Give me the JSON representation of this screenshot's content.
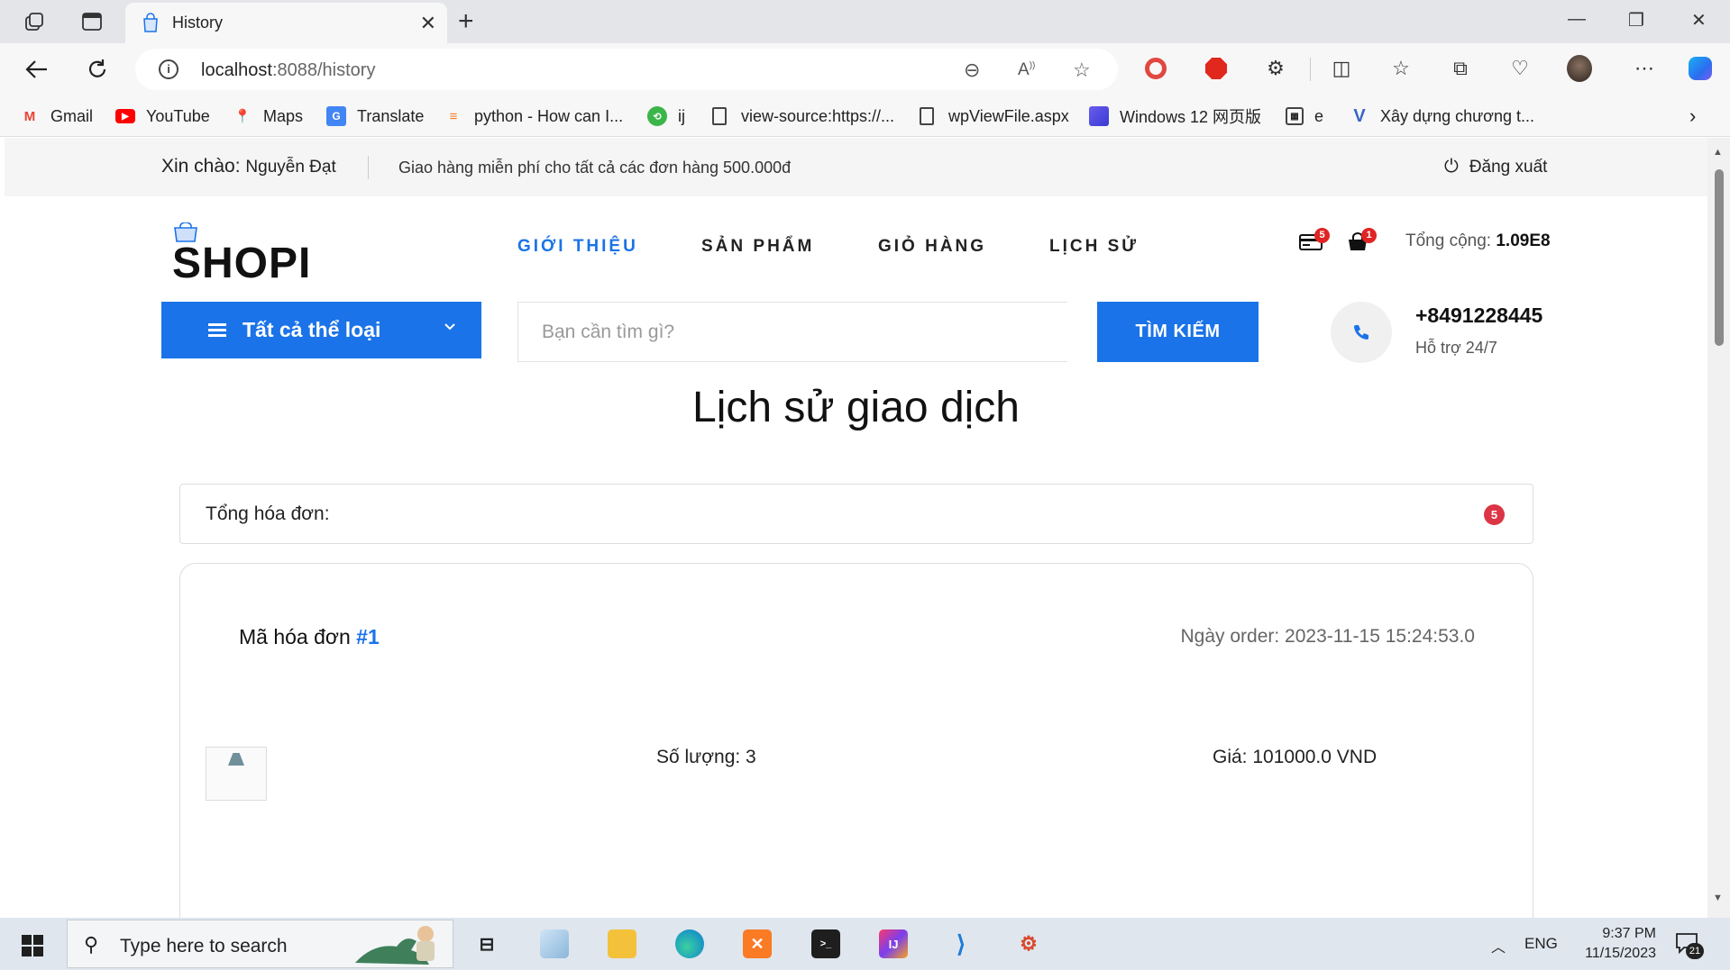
{
  "browser": {
    "tab_title": "History",
    "url_host": "localhost",
    "url_rest": ":8088/history",
    "bookmarks": [
      {
        "label": "Gmail",
        "icon": "gmail-icon"
      },
      {
        "label": "YouTube",
        "icon": "youtube-icon"
      },
      {
        "label": "Maps",
        "icon": "maps-icon"
      },
      {
        "label": "Translate",
        "icon": "translate-icon"
      },
      {
        "label": "python - How can I...",
        "icon": "stackoverflow-icon"
      },
      {
        "label": "ij",
        "icon": "ij-icon"
      },
      {
        "label": "view-source:https://...",
        "icon": "page-icon"
      },
      {
        "label": "wpViewFile.aspx",
        "icon": "page-icon"
      },
      {
        "label": "Windows 12 网页版",
        "icon": "windows12-icon"
      },
      {
        "label": "e",
        "icon": "calendar-icon"
      },
      {
        "label": "Xây dựng chương t...",
        "icon": "v-icon"
      }
    ]
  },
  "topbar": {
    "greeting": "Xin chào:",
    "user_name": "Nguyễn Đạt",
    "promo": "Giao hàng miễn phí cho tất cả các đơn hàng 500.000đ",
    "logout": "Đăng xuất"
  },
  "header": {
    "logo": "SHOPI",
    "menu": [
      "GIỚI THIỆU",
      "SẢN PHẨM",
      "GIỎ HÀNG",
      "LỊCH SỬ"
    ],
    "card_badge": "5",
    "cart_badge": "1",
    "total_label": "Tổng cộng:",
    "total_value": "1.09E8"
  },
  "search": {
    "category_label": "Tất cả thể loại",
    "placeholder": "Bạn cần tìm gì?",
    "button": "TÌM KIẾM",
    "phone": "+8491228445",
    "support": "Hỗ trợ 24/7"
  },
  "main": {
    "title": "Lịch sử giao dịch",
    "total_orders_label": "Tổng hóa đơn:",
    "total_orders_count": "5",
    "order": {
      "id_label": "Mã hóa đơn",
      "id_value": "#1",
      "date": "Ngày order: 2023-11-15 15:24:53.0",
      "qty": "Số lượng: 3",
      "price": "Giá: 101000.0 VND"
    }
  },
  "taskbar": {
    "search_placeholder": "Type here to search",
    "lang": "ENG",
    "time": "9:37 PM",
    "date": "11/15/2023",
    "notif_count": "21"
  },
  "colors": {
    "accent": "#1a73e8",
    "badge": "#dc3545"
  }
}
